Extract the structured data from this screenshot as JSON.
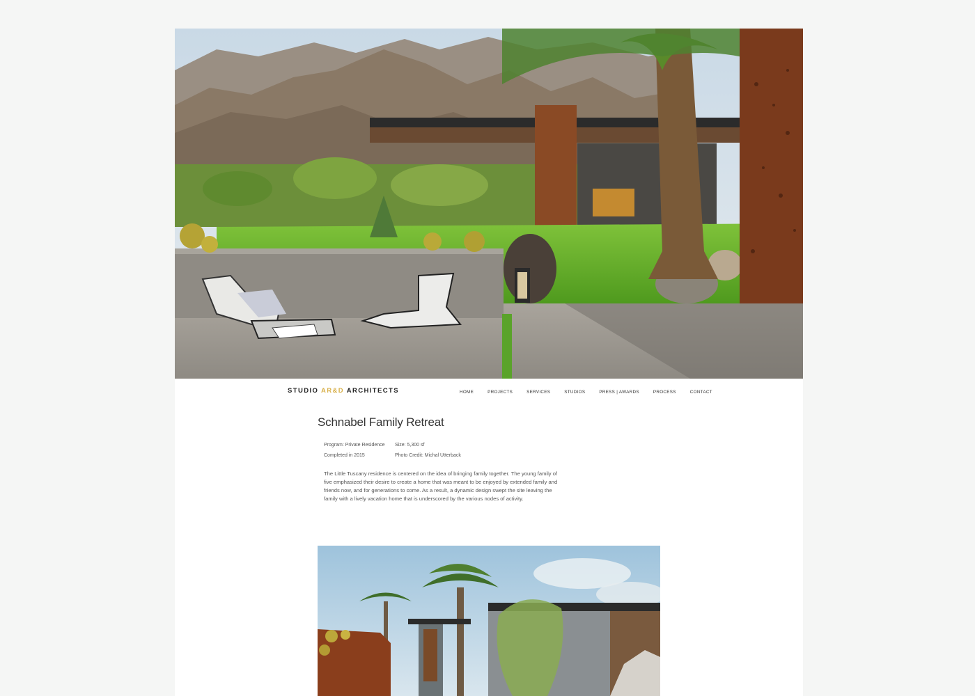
{
  "brand": {
    "prefix": "STUDIO ",
    "accent": "AR&D",
    "suffix": " ARCHITECTS",
    "accent_color": "#d8b04a"
  },
  "nav": {
    "items": [
      {
        "label": "HOME"
      },
      {
        "label": "PROJECTS"
      },
      {
        "label": "SERVICES"
      },
      {
        "label": "STUDIOS"
      },
      {
        "label": "PRESS | AWARDS"
      },
      {
        "label": "PROCESS"
      },
      {
        "label": "CONTACT"
      }
    ]
  },
  "project": {
    "title": "Schnabel Family Retreat",
    "program": "Program: Private Residence",
    "completed": "Completed in 2015",
    "size": "Size: 5,300 sf",
    "photo_credit": "Photo Credit: Michal Utterback",
    "description": "The Little Tuscany residence is centered on the idea of bringing family together. The young family of five emphasized their desire to create a home that was meant to be enjoyed by extended family and friends now, and for generations to come. As a result, a dynamic design swept the site leaving the family with a lively vacation home that is underscored by the various nodes of activity."
  }
}
